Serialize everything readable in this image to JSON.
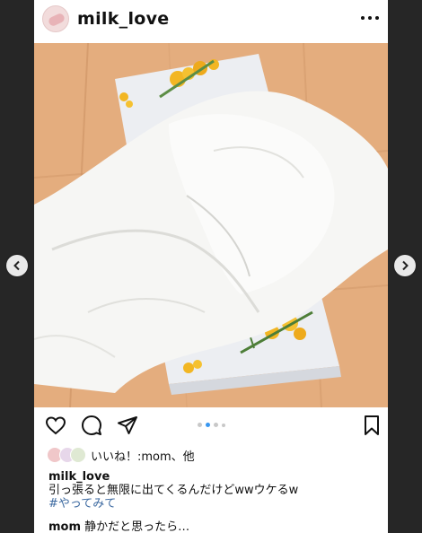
{
  "post": {
    "username": "milk_love",
    "more_icon": "more-horizontal-icon",
    "likes_text": "いいね！:mom、他",
    "caption_user": "milk_love",
    "caption_text": "引っ張ると無限に出てくるんだけどwwウケるw",
    "hashtag": "#やってみて",
    "comment_user": "mom",
    "comment_text": "静かだと思ったら…"
  },
  "carousel": {
    "current_index": 2,
    "total_dots": 4
  },
  "icons": {
    "like": "heart-icon",
    "comment": "comment-icon",
    "share": "send-icon",
    "save": "bookmark-icon",
    "prev": "chevron-left-icon",
    "next": "chevron-right-icon"
  },
  "colors": {
    "hashtag": "#3d6aa1",
    "active_dot": "#3897f0",
    "floor": "#e3ad7d",
    "tissue": "#f4f4f2",
    "flower": "#f2b623"
  }
}
